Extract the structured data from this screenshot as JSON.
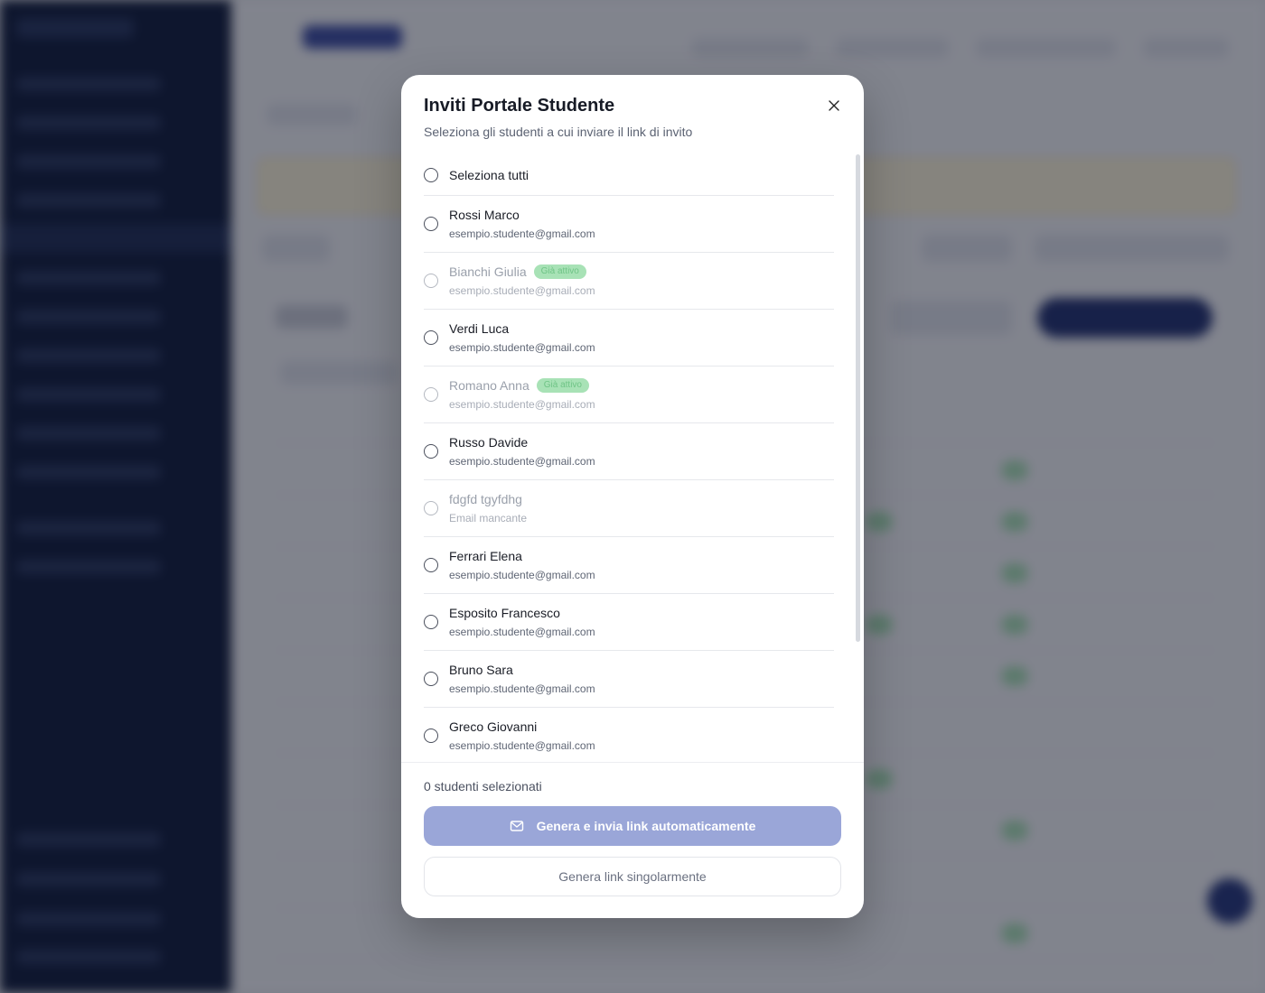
{
  "modal": {
    "title": "Inviti Portale Studente",
    "subtitle": "Seleziona gli studenti a cui inviare il link di invito",
    "select_all_label": "Seleziona tutti",
    "students": [
      {
        "name": "Rossi Marco",
        "email": "esempio.studente@gmail.com",
        "disabled": false,
        "badge": ""
      },
      {
        "name": "Bianchi Giulia",
        "email": "esempio.studente@gmail.com",
        "disabled": true,
        "badge": "Già attivo"
      },
      {
        "name": "Verdi Luca",
        "email": "esempio.studente@gmail.com",
        "disabled": false,
        "badge": ""
      },
      {
        "name": "Romano Anna",
        "email": "esempio.studente@gmail.com",
        "disabled": true,
        "badge": "Già attivo"
      },
      {
        "name": "Russo Davide",
        "email": "esempio.studente@gmail.com",
        "disabled": false,
        "badge": ""
      },
      {
        "name": "fdgfd tgyfdhg",
        "email": "Email mancante",
        "disabled": true,
        "badge": ""
      },
      {
        "name": "Ferrari Elena",
        "email": "esempio.studente@gmail.com",
        "disabled": false,
        "badge": ""
      },
      {
        "name": "Esposito Francesco",
        "email": "esempio.studente@gmail.com",
        "disabled": false,
        "badge": ""
      },
      {
        "name": "Bruno Sara",
        "email": "esempio.studente@gmail.com",
        "disabled": false,
        "badge": ""
      },
      {
        "name": "Greco Giovanni",
        "email": "esempio.studente@gmail.com",
        "disabled": false,
        "badge": ""
      }
    ],
    "selected_count": "0 studenti selezionati",
    "primary_button": "Genera e invia link automaticamente",
    "secondary_button": "Genera link singolarmente",
    "icons": {
      "close": "close-icon",
      "mail": "mail-icon"
    },
    "colors": {
      "primary_disabled": "#9aa6d8",
      "badge_bg": "#a8e2b6",
      "overlay": "rgba(15,20,35,0.50)"
    }
  }
}
